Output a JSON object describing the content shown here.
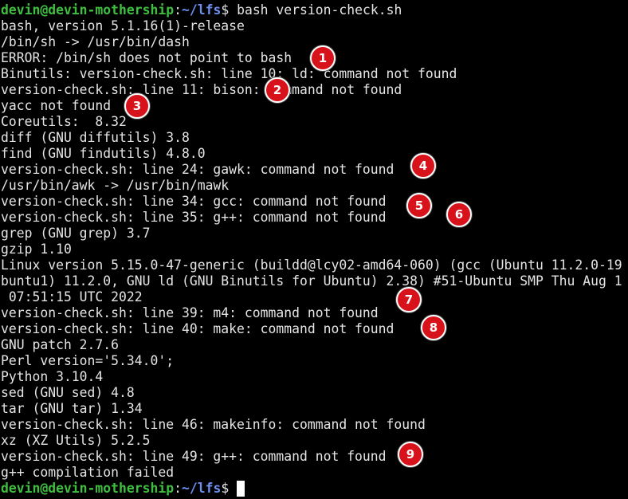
{
  "prompt": {
    "user_host": "devin@devin-mothership",
    "colon": ":",
    "path": "~/lfs",
    "sign": "$ "
  },
  "lines": [
    "bash version-check.sh",
    "bash, version 5.1.16(1)-release",
    "/bin/sh -> /usr/bin/dash",
    "ERROR: /bin/sh does not point to bash",
    "Binutils: version-check.sh: line 10: ld: command not found",
    "version-check.sh: line 11: bison: command not found",
    "yacc not found",
    "Coreutils:  8.32",
    "diff (GNU diffutils) 3.8",
    "find (GNU findutils) 4.8.0",
    "version-check.sh: line 24: gawk: command not found",
    "/usr/bin/awk -> /usr/bin/mawk",
    "version-check.sh: line 34: gcc: command not found",
    "version-check.sh: line 35: g++: command not found",
    "grep (GNU grep) 3.7",
    "gzip 1.10",
    "Linux version 5.15.0-47-generic (buildd@lcy02-amd64-060) (gcc (Ubuntu 11.2.0-19",
    "buntu1) 11.2.0, GNU ld (GNU Binutils for Ubuntu) 2.38) #51-Ubuntu SMP Thu Aug 1",
    " 07:51:15 UTC 2022",
    "version-check.sh: line 39: m4: command not found",
    "version-check.sh: line 40: make: command not found",
    "GNU patch 2.7.6",
    "Perl version='5.34.0';",
    "Python 3.10.4",
    "sed (GNU sed) 4.8",
    "tar (GNU tar) 1.34",
    "version-check.sh: line 46: makeinfo: command not found",
    "xz (XZ Utils) 5.2.5",
    "version-check.sh: line 49: g++: command not found",
    "g++ compilation failed"
  ],
  "badges": [
    "1",
    "2",
    "3",
    "4",
    "5",
    "6",
    "7",
    "8",
    "9"
  ],
  "colors": {
    "background": "#000000",
    "text": "#e4e4e4",
    "prompt_user": "#3fbf3f",
    "prompt_path": "#6c8ff0",
    "badge_fill": "#d8121a",
    "badge_border": "#ffffff"
  }
}
